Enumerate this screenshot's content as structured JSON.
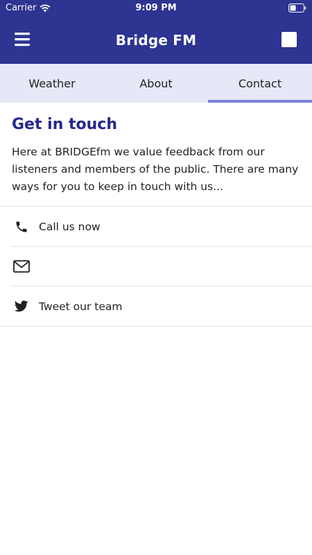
{
  "status_bar": {
    "carrier": "Carrier",
    "time": "9:09 PM"
  },
  "app_bar": {
    "title": "Bridge FM",
    "background": "#2d3491"
  },
  "tabs": [
    {
      "label": "Weather",
      "active": false
    },
    {
      "label": "About",
      "active": false
    },
    {
      "label": "Contact",
      "active": true
    }
  ],
  "contact": {
    "heading": "Get in touch",
    "intro": "Here at BRIDGEfm we value feedback from our listeners and members of the public. There are many ways for you to keep in touch with us...",
    "items": [
      {
        "icon": "phone-icon",
        "label": "Call us now"
      },
      {
        "icon": "email-icon",
        "label": ""
      },
      {
        "icon": "twitter-icon",
        "label": "Tweet our team"
      }
    ]
  },
  "colors": {
    "accent": "#25278c",
    "tab_background": "#e6e7f7",
    "tab_indicator": "#7b7fd8"
  }
}
